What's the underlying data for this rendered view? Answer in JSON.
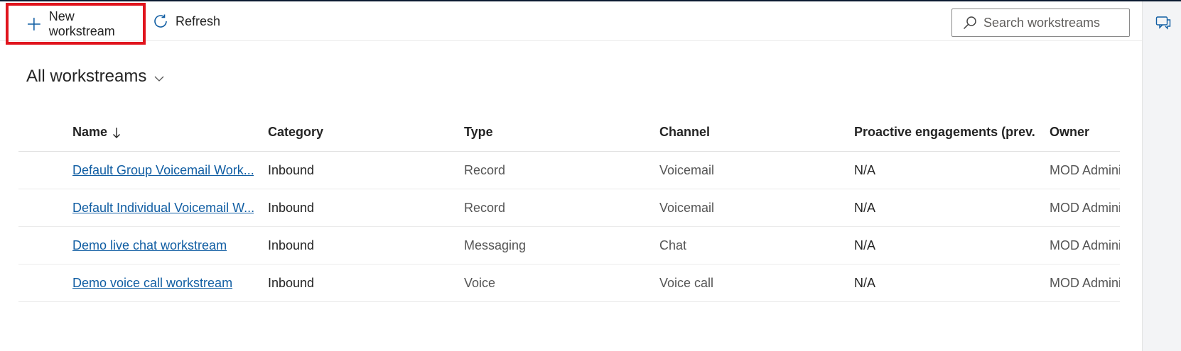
{
  "toolbar": {
    "new_label": "New workstream",
    "refresh_label": "Refresh",
    "search_placeholder": "Search workstreams"
  },
  "view": {
    "title": "All workstreams"
  },
  "grid": {
    "headers": {
      "name": "Name",
      "category": "Category",
      "type": "Type",
      "channel": "Channel",
      "proactive": "Proactive engagements (prev...",
      "owner": "Owner"
    },
    "rows": [
      {
        "name": "Default Group Voicemail Work...",
        "category": "Inbound",
        "type": "Record",
        "channel": "Voicemail",
        "proactive": "N/A",
        "owner": "MOD Admini"
      },
      {
        "name": "Default Individual Voicemail W...",
        "category": "Inbound",
        "type": "Record",
        "channel": "Voicemail",
        "proactive": "N/A",
        "owner": "MOD Admini"
      },
      {
        "name": "Demo live chat workstream",
        "category": "Inbound",
        "type": "Messaging",
        "channel": "Chat",
        "proactive": "N/A",
        "owner": "MOD Admini"
      },
      {
        "name": "Demo voice call workstream",
        "category": "Inbound",
        "type": "Voice",
        "channel": "Voice call",
        "proactive": "N/A",
        "owner": "MOD Admini"
      }
    ]
  },
  "icons": {
    "add": "plus-icon",
    "refresh": "refresh-icon",
    "search": "search-icon",
    "chevron": "chevron-down-icon",
    "sort": "sort-arrow-down-icon",
    "chat": "chat-icon"
  },
  "colors": {
    "highlight": "#e0141d",
    "accent": "#115ea3",
    "link": "#115ea3"
  }
}
